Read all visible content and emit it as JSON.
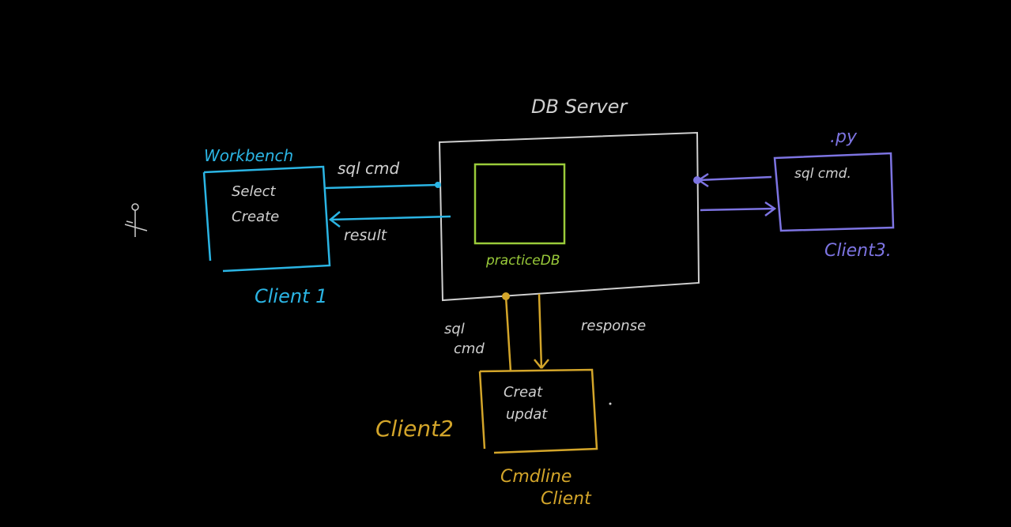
{
  "colors": {
    "background": "#000000",
    "server": "#cfcfcf",
    "client1": "#2bb5e4",
    "database": "#9acb3a",
    "client2": "#d3a52a",
    "client3": "#7d74e2",
    "note_text": "#d0d0d0"
  },
  "server": {
    "title": "DB Server",
    "database_label": "practiceDB"
  },
  "client1": {
    "tool": "Workbench",
    "commands": [
      "Select",
      "Create"
    ],
    "label": "Client 1",
    "request_label": "sql cmd",
    "response_label": "result"
  },
  "client2": {
    "commands": [
      "Creat",
      "updat"
    ],
    "label": "Client2",
    "tool": [
      "Cmdline",
      "Client"
    ],
    "request_label": [
      "sql",
      "cmd"
    ],
    "response_label": "response"
  },
  "client3": {
    "tool": ".py",
    "commands": "sql cmd.",
    "label": "Client3."
  },
  "icons": {
    "pen_cursor": "pen-cursor-icon"
  }
}
